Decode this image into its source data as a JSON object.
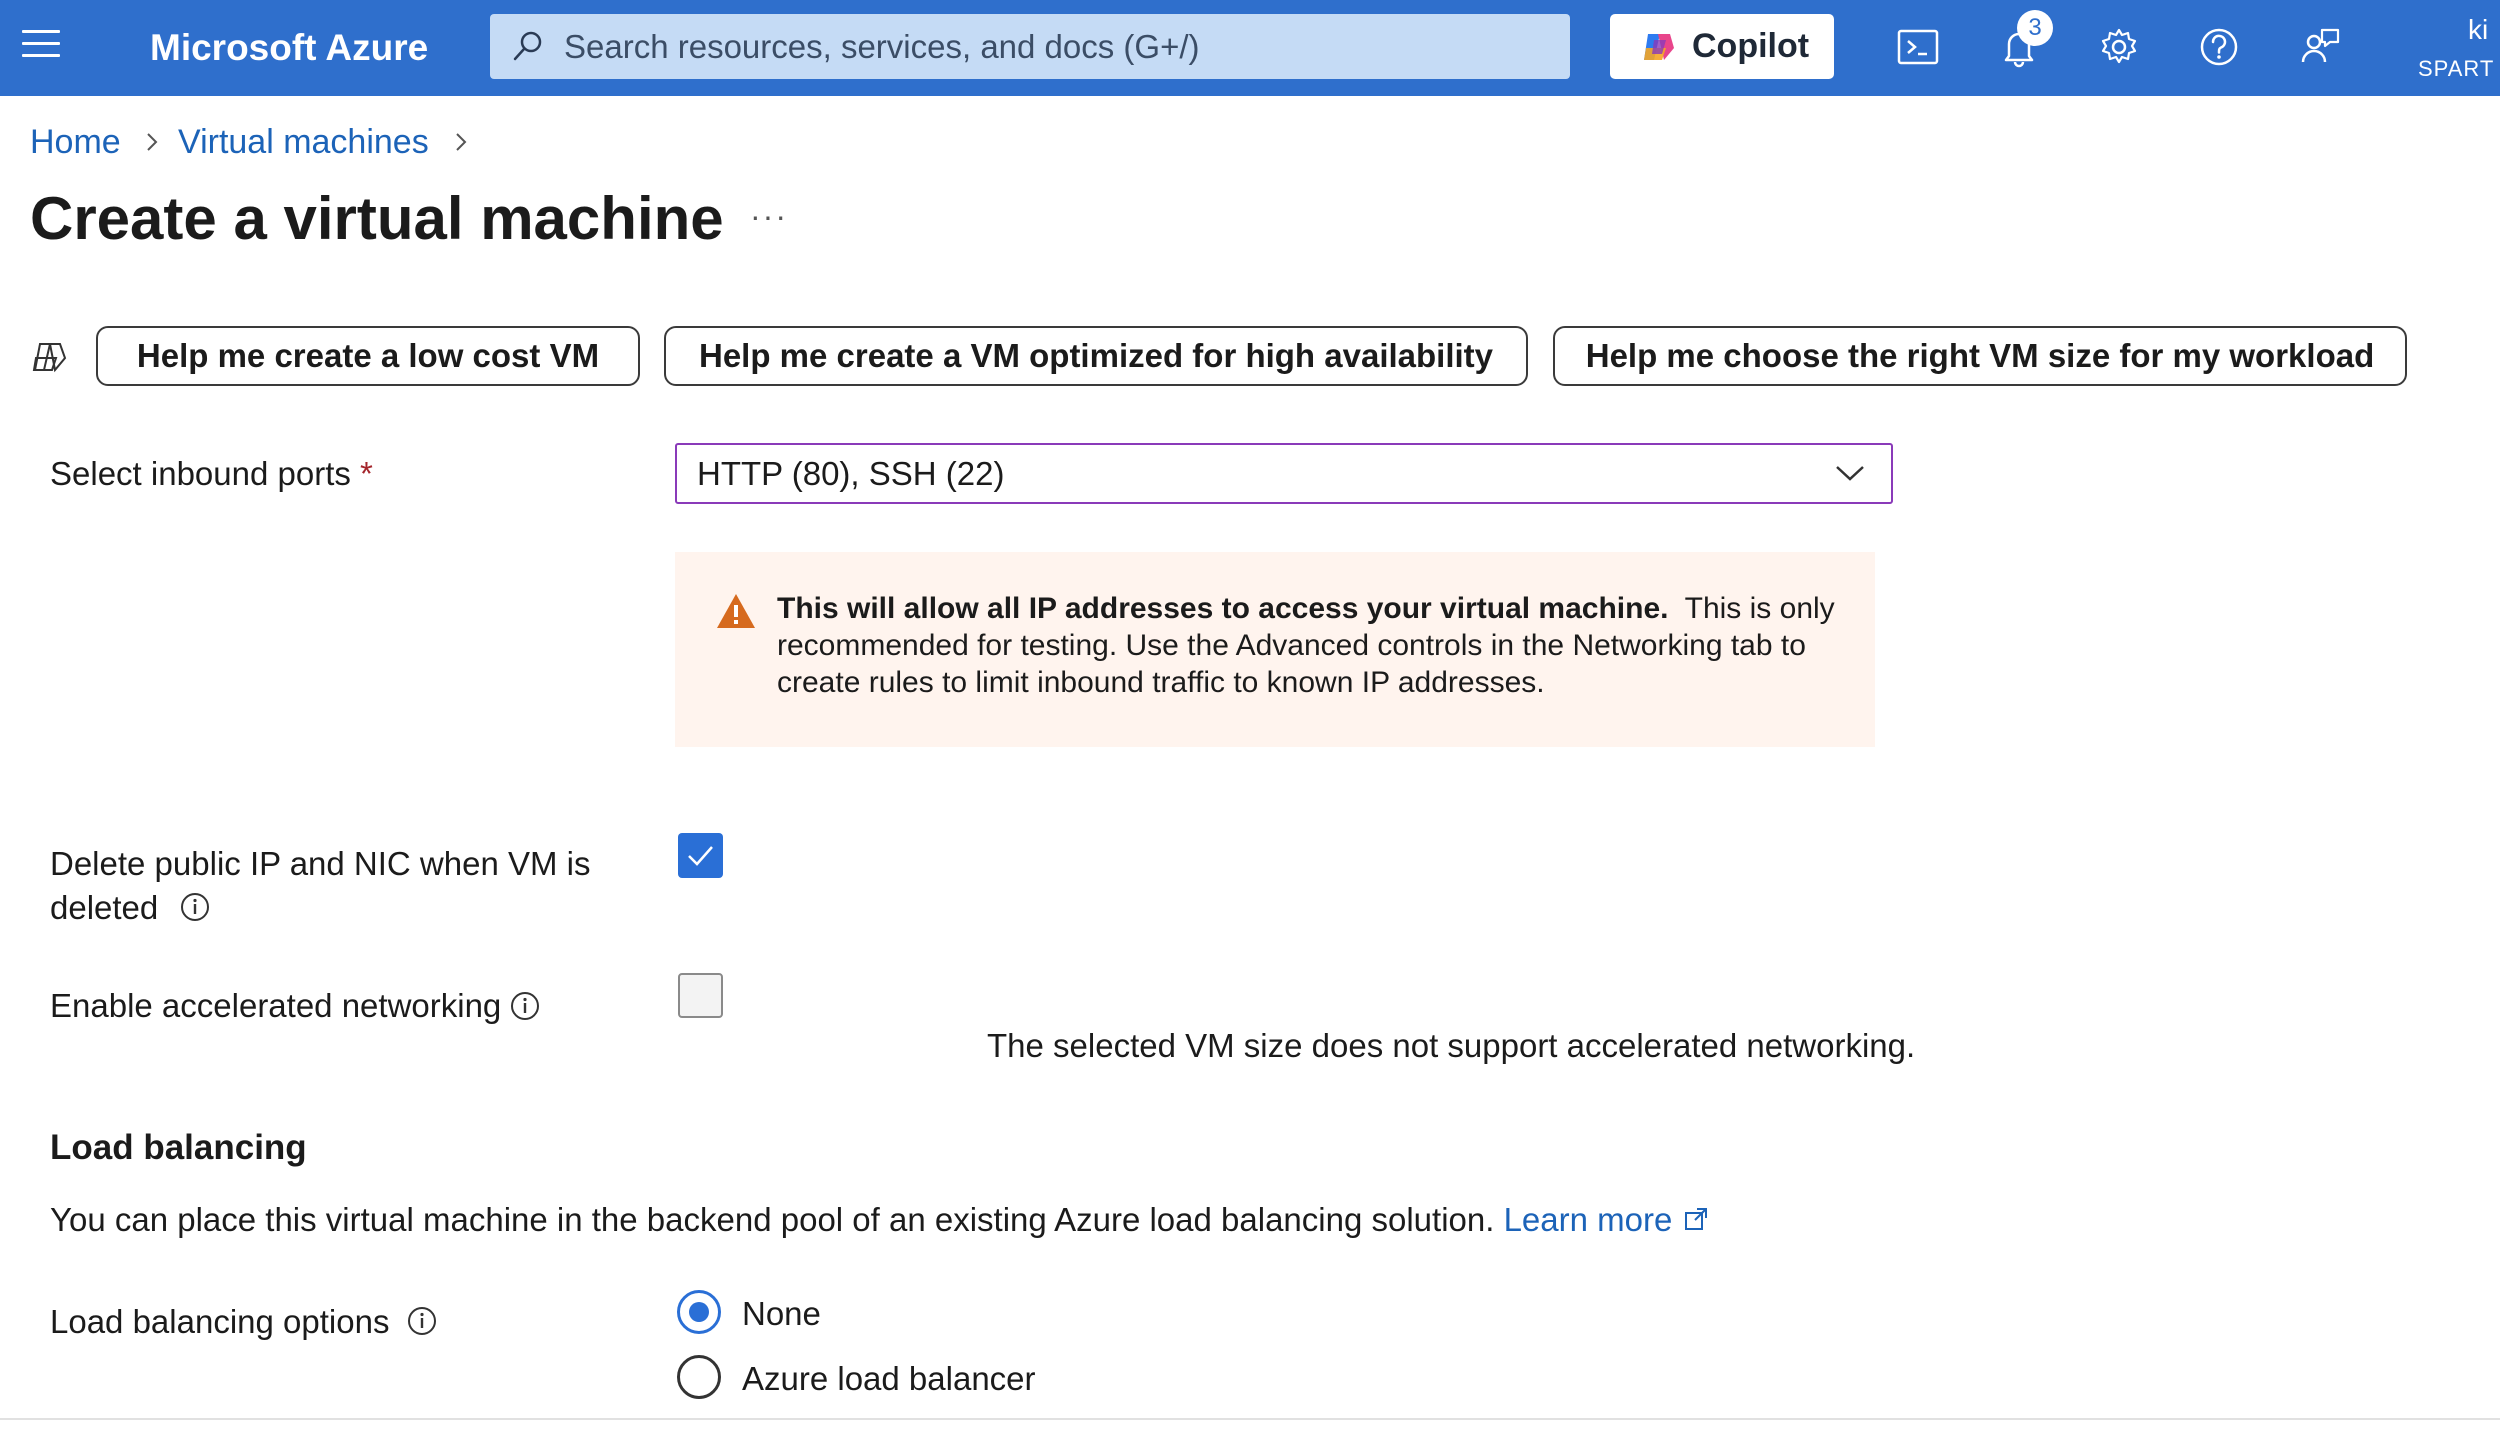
{
  "topbar": {
    "brand": "Microsoft Azure",
    "search_placeholder": "Search resources, services, and docs (G+/)",
    "copilot_label": "Copilot",
    "notification_count": "3",
    "user_initials": "ki",
    "user_org": "SPART",
    "icons": [
      "menu-icon",
      "search-icon",
      "copilot-icon",
      "cloud-shell-icon",
      "bell-icon",
      "gear-icon",
      "help-icon",
      "feedback-icon"
    ]
  },
  "breadcrumb": {
    "home": "Home",
    "virtual_machines": "Virtual machines"
  },
  "page": {
    "title": "Create a virtual machine",
    "more": "···"
  },
  "copilot_prompts": [
    "Help me create a low cost VM",
    "Help me create a VM optimized for high availability",
    "Help me choose the right VM size for my workload"
  ],
  "inbound_ports": {
    "label": "Select inbound ports",
    "required_mark": "*",
    "value": "HTTP (80), SSH (22)"
  },
  "warning": {
    "bold": "This will allow all IP addresses to access your virtual machine.",
    "text": "This is only recommended for testing.  Use the Advanced controls in the Networking tab to create rules to limit inbound traffic to known IP addresses."
  },
  "delete_public_ip": {
    "label_line1": "Delete public IP and NIC when VM is",
    "label_line2": "deleted",
    "checked": true
  },
  "accelerated_networking": {
    "label": "Enable accelerated networking",
    "checked": false,
    "note": "The selected VM size does not support accelerated networking."
  },
  "load_balancing": {
    "heading": "Load balancing",
    "description": "You can place this virtual machine in the backend pool of an existing Azure load balancing solution.",
    "learn_more": "Learn more",
    "options_label": "Load balancing options",
    "options": [
      "None",
      "Azure load balancer"
    ],
    "selected": "None"
  },
  "colors": {
    "topbar": "#2f6fcc",
    "accent": "#2a6fd6",
    "link": "#1c63b8",
    "warning_bg": "#fff4ee",
    "warning_icon": "#d66a1e",
    "dropdown_border": "#8a3ab9"
  }
}
